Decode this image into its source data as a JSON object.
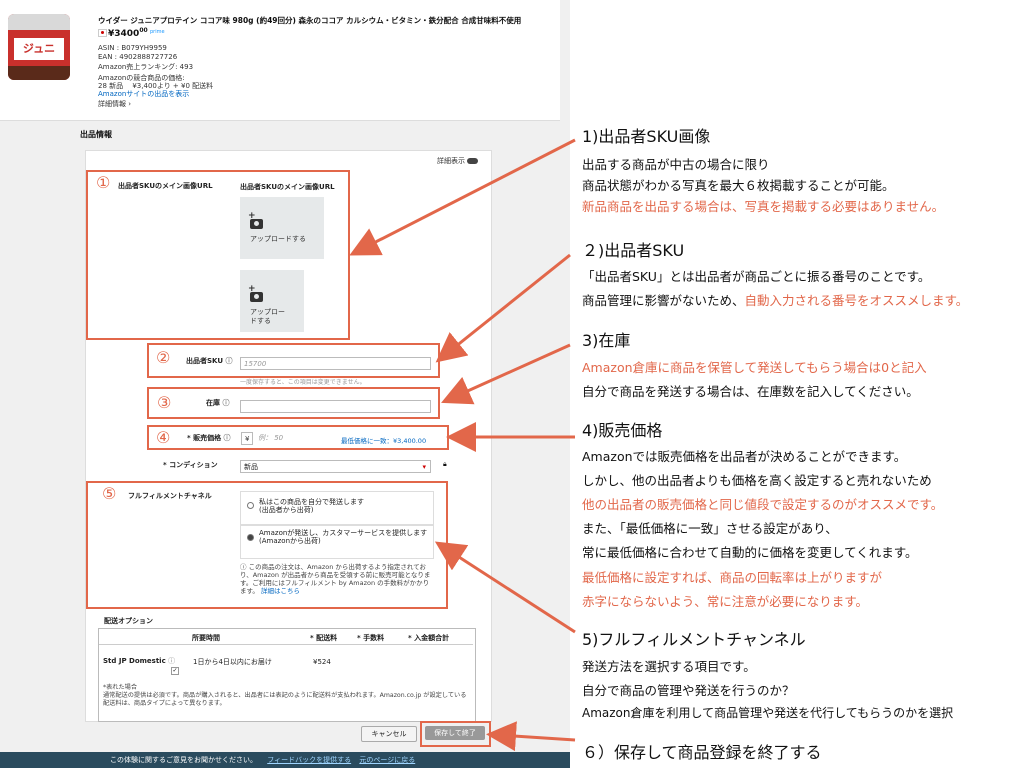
{
  "product": {
    "title": "ウイダー ジュニアプロテイン ココア味 980g (約49回分) 森永のココア カルシウム・ビタミン・鉄分配合 合成甘味料不使用",
    "thumb_label": "ジュニ",
    "price": "¥3400",
    "price_cents": "00",
    "prime": "prime",
    "asin": "ASIN : B079YH9959",
    "ean": "EAN : 4902888727726",
    "ranking": "Amazon売上ランキング: 493",
    "offers_heading": "Amazonの競合商品の価格:",
    "offers_detail": "28 新品 　¥3,400より + ¥0 配送料",
    "view_on_amazon": "Amazonサイトの出品を表示",
    "details_link": "詳細情報 ›"
  },
  "form": {
    "section_title": "出品情報",
    "advanced_toggle_label": "詳細表示",
    "image_label": "出品者SKUのメイン画像URL",
    "image_field_label": "出品者SKUのメイン画像URL",
    "upload_label": "アップロードする",
    "sku_label": "出品者SKU",
    "sku_placeholder": "15700",
    "sku_hint": "一度保存すると、この項目は変更できません。",
    "stock_label": "在庫",
    "price_label": "* 販売価格",
    "price_currency": "¥",
    "price_placeholder": "例： 50",
    "price_match": "最低価格に一致：¥3,400.00",
    "condition_label": "* コンディション",
    "condition_value": "新品",
    "fulfillment_label": "フルフィルメントチャネル",
    "fulfill_option_self": "私はこの商品を自分で発送します\n(出品者から出荷)",
    "fulfill_option_fba": "Amazonが発送し、カスタマーサービスを提供します\n(Amazonから出荷)",
    "fulfill_note": "ⓘ この商品の注文は、Amazon から出荷するよう指定されており、Amazon が出品者から商品を受領する前に販売可能となります。ご利用にはフルフィルメント by Amazon の手数料がかかります。",
    "fulfill_note_link": "詳細はこちら",
    "shipping_title": "配送オプション",
    "shipping_headers": [
      "所要時間",
      "* 配送料",
      "* 手数料",
      "* 入金額合計"
    ],
    "shipping_row": {
      "name": "Std JP Domestic",
      "time": "1日から4日以内にお届け",
      "fee": "¥524"
    },
    "shipping_note": "*表れた場合\n通常配送の提供は必須です。商品が購入されると、出品者には表記のように配送料が支払われます。Amazon.co.jp が設定している配送料は、商品タイプによって異なります。",
    "cancel_button": "キャンセル",
    "save_button": "保存して終了"
  },
  "footer": {
    "text": "この体験に関するご意見をお聞かせください。",
    "feedback_link": "フィードバックを提供する",
    "back_link": "元のページに戻る"
  },
  "markers": [
    "①",
    "②",
    "③",
    "④",
    "⑤"
  ],
  "annotations": {
    "a1_title": "1)出品者SKU画像",
    "a1_line1": "出品する商品が中古の場合に限り",
    "a1_line2": "商品状態がわかる写真を最大６枚掲載することが可能。",
    "a1_line3": "新品商品を出品する場合は、写真を掲載する必要はありません。",
    "a2_title": "２)出品者SKU",
    "a2_line1": "「出品者SKU」とは出品者が商品ごとに振る番号のことです。",
    "a2_line2a": "商品管理に影響がないため、",
    "a2_line2b": "自動入力される番号をオススメします。",
    "a3_title": "3)在庫",
    "a3_line1": "Amazon倉庫に商品を保管して発送してもらう場合は0と記入",
    "a3_line2": "自分で商品を発送する場合は、在庫数を記入してください。",
    "a4_title": "4)販売価格",
    "a4_line1": "Amazonでは販売価格を出品者が決めることができます。",
    "a4_line2": "しかし、他の出品者よりも価格を高く設定すると売れないため",
    "a4_line3": "他の出品者の販売価格と同じ値段で設定するのがオススメです。",
    "a4_line4": "また、「最低価格に一致」させる設定があり、",
    "a4_line5": "常に最低価格に合わせて自動的に価格を変更してくれます。",
    "a4_line6": "最低価格に設定すれば、商品の回転率は上がりますが",
    "a4_line7": "赤字にならないよう、常に注意が必要になります。",
    "a5_title": "5)フルフィルメントチャンネル",
    "a5_line1": "発送方法を選択する項目です。",
    "a5_line2": "自分で商品の管理や発送を行うのか？",
    "a5_line3": "Amazon倉庫を利用して商品管理や発送を代行してもらうのかを選択",
    "a6_title": "６）保存して商品登録を終了する"
  },
  "colors": {
    "annotation_red": "#e2674a",
    "link_blue": "#0066c0",
    "footer_bg": "#2a4b5e"
  }
}
